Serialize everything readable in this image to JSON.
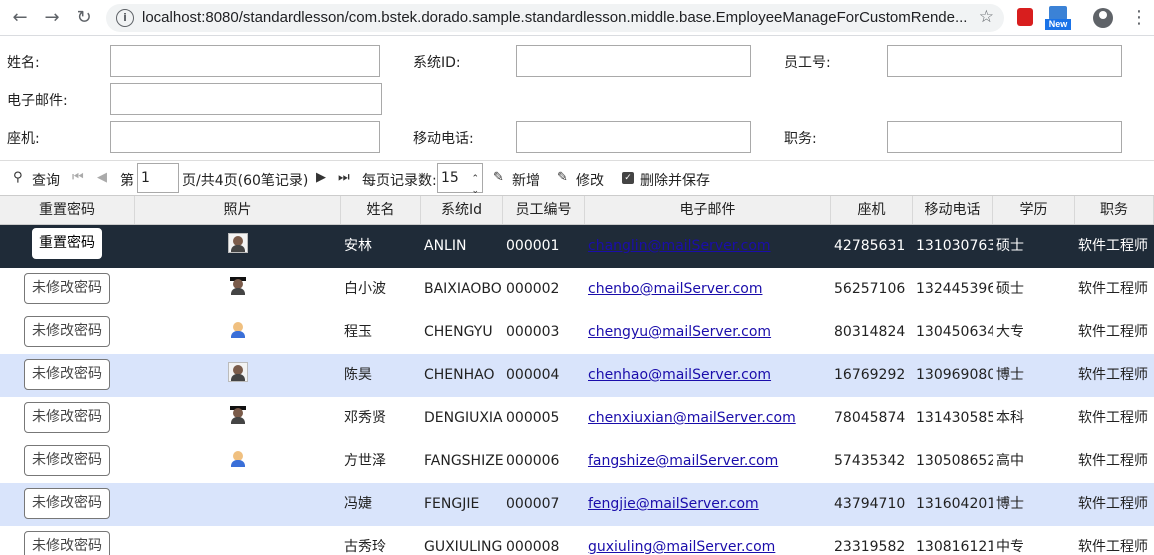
{
  "browser": {
    "url": "localhost:8080/standardlesson/com.bstek.dorado.sample.standardlesson.middle.base.EmployeeManageForCustomRende...",
    "new_badge": "New"
  },
  "form": {
    "name_label": "姓名:",
    "system_id_label": "系统ID:",
    "employee_no_label": "员工号:",
    "email_label": "电子邮件:",
    "phone_label": "座机:",
    "mobile_label": "移动电话:",
    "position_label": "职务:"
  },
  "toolbar": {
    "query": "查询",
    "page_prefix": "第",
    "page_value": "1",
    "page_suffix": "页/共4页(60笔记录)",
    "page_size_label": "每页记录数:",
    "page_size_value": "15",
    "add": "新增",
    "modify": "修改",
    "delete_save": "删除并保存"
  },
  "grid": {
    "columns": [
      "重置密码",
      "照片",
      "姓名",
      "系统Id",
      "员工编号",
      "电子邮件",
      "座机",
      "移动电话",
      "学历",
      "职务"
    ],
    "rows": [
      {
        "btn": "重置密码",
        "photo": "female",
        "name": "安林",
        "sysid": "ANLIN",
        "empno": "000001",
        "email": "changlin@mailServer.com",
        "phone": "42785631",
        "mobile": "131030763",
        "edu": "硕士",
        "title": "软件工程师"
      },
      {
        "btn": "未修改密码",
        "photo": "grad",
        "name": "白小波",
        "sysid": "BAIXIAOBO",
        "empno": "000002",
        "email": "chenbo@mailServer.com",
        "phone": "56257106",
        "mobile": "132445396",
        "edu": "硕士",
        "title": "软件工程师"
      },
      {
        "btn": "未修改密码",
        "photo": "kid",
        "name": "程玉",
        "sysid": "CHENGYU",
        "empno": "000003",
        "email": "chengyu@mailServer.com",
        "phone": "80314824",
        "mobile": "130450634",
        "edu": "大专",
        "title": "软件工程师"
      },
      {
        "btn": "未修改密码",
        "photo": "female",
        "name": "陈昊",
        "sysid": "CHENHAO",
        "empno": "000004",
        "email": "chenhao@mailServer.com",
        "phone": "16769292",
        "mobile": "130969080",
        "edu": "博士",
        "title": "软件工程师"
      },
      {
        "btn": "未修改密码",
        "photo": "grad",
        "name": "邓秀贤",
        "sysid": "DENGIUXIA",
        "empno": "000005",
        "email": "chenxiuxian@mailServer.com",
        "phone": "78045874",
        "mobile": "131430585",
        "edu": "本科",
        "title": "软件工程师"
      },
      {
        "btn": "未修改密码",
        "photo": "kid",
        "name": "方世泽",
        "sysid": "FANGSHIZE",
        "empno": "000006",
        "email": "fangshize@mailServer.com",
        "phone": "57435342",
        "mobile": "130508652",
        "edu": "高中",
        "title": "软件工程师"
      },
      {
        "btn": "未修改密码",
        "photo": "",
        "name": "冯婕",
        "sysid": "FENGJIE",
        "empno": "000007",
        "email": "fengjie@mailServer.com",
        "phone": "43794710",
        "mobile": "131604201",
        "edu": "博士",
        "title": "软件工程师"
      },
      {
        "btn": "未修改密码",
        "photo": "",
        "name": "古秀玲",
        "sysid": "GUXIULING",
        "empno": "000008",
        "email": "guxiuling@mailServer.com",
        "phone": "23319582",
        "mobile": "130816121",
        "edu": "中专",
        "title": "软件工程师"
      }
    ]
  }
}
